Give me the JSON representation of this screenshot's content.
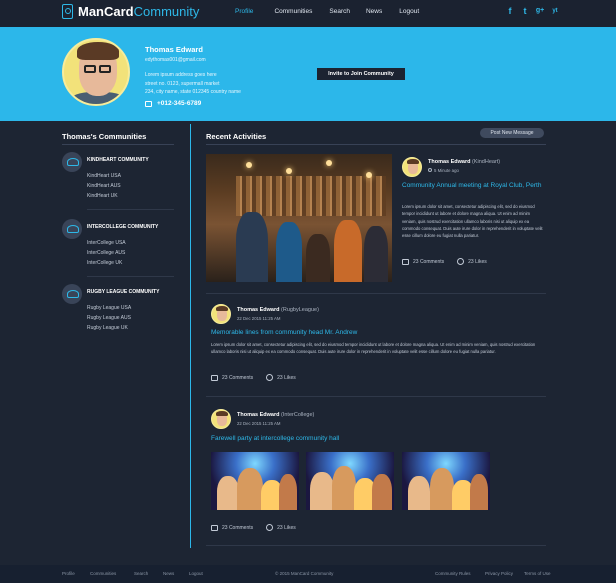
{
  "brand": {
    "name_bold": "ManCard",
    "name_light": "Community"
  },
  "nav": {
    "items": [
      "Profile",
      "Communities",
      "Search",
      "News",
      "Logout"
    ],
    "active": "Profile"
  },
  "social": [
    "f",
    "t",
    "g+",
    "yt"
  ],
  "profile": {
    "name": "Thomas Edward",
    "email": "edythomas001@gmail.com",
    "address": [
      "Lorem ipsum address goes here",
      "street no. 0123, supermall market",
      "234, city name, state 012345 country name"
    ],
    "phone": "+012-345-6789",
    "invite_label": "Invite to Join Community"
  },
  "sidebar": {
    "title": "Thomas's Communities",
    "groups": [
      {
        "title": "KINDHEART COMMUNITY",
        "items": [
          "KindHeart USA",
          "KindHeart AUS",
          "KindHeart UK"
        ]
      },
      {
        "title": "INTERCOLLEGE COMMUNITY",
        "items": [
          "InterCollege USA",
          "InterCollege AUS",
          "InterCollege UK"
        ]
      },
      {
        "title": "RUGBY LEAGUE COMMUNITY",
        "items": [
          "Rugby League USA",
          "Rugby League AUS",
          "Rugby League UK"
        ]
      }
    ]
  },
  "main": {
    "title": "Recent Activities",
    "post_button": "Post New Message",
    "activities": [
      {
        "author": "Thomas Edward",
        "group": "(KindHeart)",
        "time": "5 Minute ago",
        "headline": "Community Annual meeting at Royal Club, Perth",
        "body": "Lorem ipsum dolor sit amet, consectetur adipiscing elit, sed do eiusmod tempor incididunt ut labore et dolore magna aliqua. Ut enim ad minim veniam, quis nostrud exercitation ullamco laboris nisi ut aliquip ex ea commodo consequat. Duis aute irure dolor in reprehenderit in voluptate velit esse cillum dolore eu fugiat nulla pariatur.",
        "comments": "23  Comments",
        "likes": "23  Likes"
      },
      {
        "author": "Thomas Edward",
        "group": "(RugbyLeague)",
        "time": "22 Dec 2015    11:25 AM",
        "headline": "Memorable lines from community head Mr. Andrew",
        "body": "Lorem ipsum dolor sit amet, consectetur adipiscing elit, sed do eiusmod tempor incididunt ut labore et dolore magna aliqua. Ut enim ad minim veniam, quis nostrud exercitation ullamco laboris nisi ut aliquip ex ea commodo consequat. Duis aute irure dolor in reprehenderit in voluptate velit esse cillum dolore eu fugiat nulla pariatur.",
        "comments": "23  Comments",
        "likes": "23  Likes"
      },
      {
        "author": "Thomas Edward",
        "group": "(InterCollege)",
        "time": "22 Dec 2015    11:25 AM",
        "headline": "Farewell party at intercollege community hall",
        "comments": "23  Comments",
        "likes": "23  Likes"
      }
    ]
  },
  "footer": {
    "links_left": [
      "Profile",
      "Communities",
      "Search",
      "News",
      "Logout"
    ],
    "copyright": "© 2015 ManCard Community",
    "links_right": [
      "Community Rules",
      "Privacy Policy",
      "Terms of Use"
    ]
  },
  "colors": {
    "accent": "#2cb7ea",
    "background": "#1d2533",
    "nav": "#1b2230",
    "button_dark": "#1c2331"
  }
}
